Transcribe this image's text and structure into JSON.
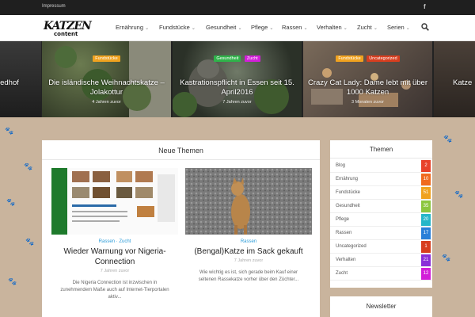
{
  "topbar": {
    "link": "Impressum",
    "social": "f"
  },
  "nav": {
    "logo_top": "KATZEN",
    "logo_bottom": "content",
    "items": [
      {
        "label": "Ernährung"
      },
      {
        "label": "Fundstücke"
      },
      {
        "label": "Gesundheit"
      },
      {
        "label": "Pflege"
      },
      {
        "label": "Rassen"
      },
      {
        "label": "Verhalten"
      },
      {
        "label": "Zucht"
      },
      {
        "label": "Serien"
      }
    ],
    "caret": "⌄"
  },
  "slider": [
    {
      "title_partial": "iedhof"
    },
    {
      "badges": [
        {
          "label": "Fundstücke",
          "color": "#f0a21f"
        }
      ],
      "title": "Die isländische Weihnachtskatze – Jolakottur",
      "time": "4 Jahren zuvor"
    },
    {
      "badges": [
        {
          "label": "Gesundheit",
          "color": "#2fb34a"
        },
        {
          "label": "Zucht",
          "color": "#d21fd8"
        }
      ],
      "title": "Kastrationspflicht in Essen seit 15. April2016",
      "time": "7 Jahren zuvor"
    },
    {
      "badges": [
        {
          "label": "Fundstücke",
          "color": "#f0a21f"
        },
        {
          "label": "Uncategorized",
          "color": "#d73e1f"
        }
      ],
      "title": "Crazy Cat Lady: Dame lebt mit über 1000 Katzen",
      "time": "3 Monaten zuvor"
    },
    {
      "title_partial": "Katze"
    }
  ],
  "main": {
    "heading": "Neue Themen",
    "cards": [
      {
        "category": "Rassen · Zucht",
        "title": "Wieder Warnung vor Nigeria-Connection",
        "time": "7 Jahren zuvor",
        "excerpt": "Die Nigeria Connection ist inzwischen in zunehmendem Maße auch auf Internet-Tierportalen aktiv..."
      },
      {
        "category": "Rassen",
        "title": "(Bengal)Katze im Sack gekauft",
        "time": "7 Jahren zuvor",
        "excerpt": "Wie wichtig es ist, sich gerade beim Kauf einer seltenen Rassekatze vorher über den Züchter..."
      }
    ]
  },
  "sidebar": {
    "heading": "Themen",
    "items": [
      {
        "name": "Blog",
        "count": "2",
        "color": "#e8422a"
      },
      {
        "name": "Ernährung",
        "count": "10",
        "color": "#f06a1f"
      },
      {
        "name": "Fundstücke",
        "count": "51",
        "color": "#f0a21f"
      },
      {
        "name": "Gesundheit",
        "count": "35",
        "color": "#8cc63f"
      },
      {
        "name": "Pflege",
        "count": "20",
        "color": "#26b6c8"
      },
      {
        "name": "Rassen",
        "count": "17",
        "color": "#2a7fd8"
      },
      {
        "name": "Uncategorized",
        "count": "1",
        "color": "#d73e1f"
      },
      {
        "name": "Verhalten",
        "count": "21",
        "color": "#8a2fd8"
      },
      {
        "name": "Zucht",
        "count": "12",
        "color": "#d21fd8"
      }
    ],
    "newsletter": "Newsletter"
  }
}
